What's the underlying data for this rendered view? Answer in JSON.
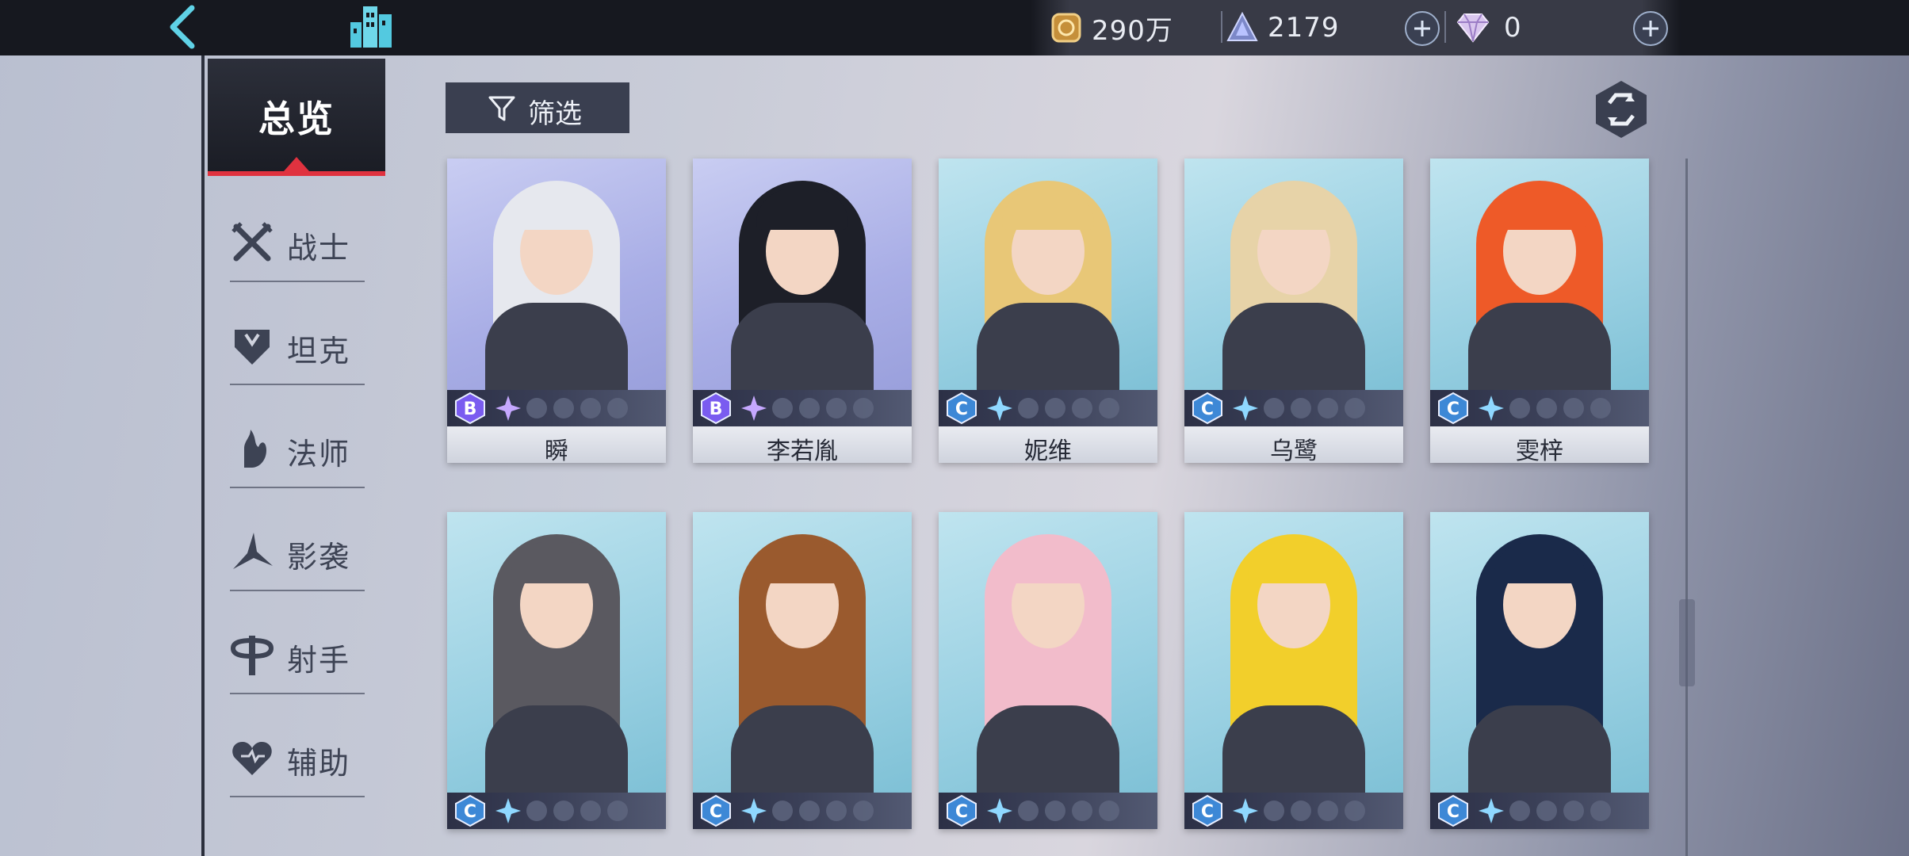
{
  "topbar": {
    "back_icon": "back-chevron-icon",
    "home_icon": "city-icon",
    "gold": {
      "icon": "coin-icon",
      "value": "290万"
    },
    "crystal": {
      "icon": "crystal-icon",
      "value": "2179"
    },
    "gem": {
      "icon": "diamond-icon",
      "value": "0"
    },
    "plus_icon": "plus-icon"
  },
  "sidebar": {
    "overview_label": "总览",
    "classes": [
      {
        "label": "战士",
        "icon": "crossed-swords-icon"
      },
      {
        "label": "坦克",
        "icon": "shield-icon"
      },
      {
        "label": "法师",
        "icon": "flame-staff-icon"
      },
      {
        "label": "影袭",
        "icon": "shuriken-icon"
      },
      {
        "label": "射手",
        "icon": "crosshair-icon"
      },
      {
        "label": "辅助",
        "icon": "heart-icon"
      }
    ]
  },
  "toolbar": {
    "filter_label": "筛选",
    "filter_icon": "funnel-icon",
    "refresh_icon": "refresh-icon"
  },
  "colors": {
    "accent_red": "#e0323f",
    "rank_b": "#7a5cf0",
    "rank_c": "#3d88d6",
    "star": "#8fd8ff"
  },
  "heroes": [
    {
      "name": "瞬",
      "rank": "B",
      "stars": 1,
      "hair": "#e6e8ee"
    },
    {
      "name": "李若胤",
      "rank": "B",
      "stars": 1,
      "hair": "#1d1f28"
    },
    {
      "name": "妮维",
      "rank": "C",
      "stars": 1,
      "hair": "#e8c777"
    },
    {
      "name": "乌鹭",
      "rank": "C",
      "stars": 1,
      "hair": "#e7d3a8"
    },
    {
      "name": "雯梓",
      "rank": "C",
      "stars": 1,
      "hair": "#ee5a28"
    },
    {
      "name": "",
      "rank": "C",
      "stars": 1,
      "hair": "#5a5960"
    },
    {
      "name": "",
      "rank": "C",
      "stars": 1,
      "hair": "#9a5a2e"
    },
    {
      "name": "",
      "rank": "C",
      "stars": 1,
      "hair": "#f2bccb"
    },
    {
      "name": "",
      "rank": "C",
      "stars": 1,
      "hair": "#f2cf2b"
    },
    {
      "name": "",
      "rank": "C",
      "stars": 1,
      "hair": "#1a2a4a"
    }
  ]
}
